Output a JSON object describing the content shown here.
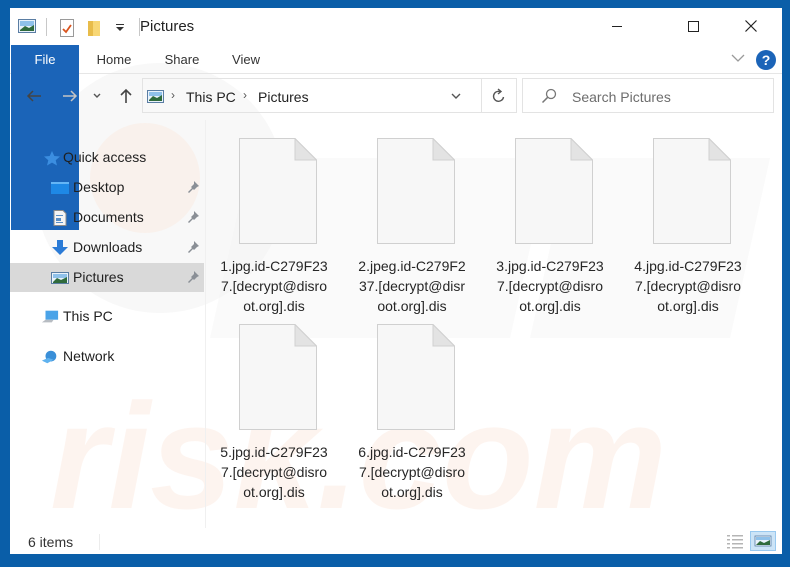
{
  "window": {
    "title": "Pictures",
    "controls": {
      "minimize": "—",
      "maximize": "☐",
      "close": "✕"
    }
  },
  "ribbon": {
    "tabs": [
      {
        "label": "File",
        "active": true
      },
      {
        "label": "Home"
      },
      {
        "label": "Share"
      },
      {
        "label": "View"
      }
    ],
    "help": "?"
  },
  "address": {
    "back": "←",
    "forward": "→",
    "recent": "⌄",
    "up": "↑",
    "breadcrumb": [
      "This PC",
      "Pictures"
    ],
    "separator": "›",
    "refresh": "↻"
  },
  "search": {
    "placeholder": "Search Pictures"
  },
  "navpane": {
    "quick_access": {
      "label": "Quick access"
    },
    "pinned": [
      {
        "label": "Desktop",
        "icon": "desktop-icon"
      },
      {
        "label": "Documents",
        "icon": "documents-icon"
      },
      {
        "label": "Downloads",
        "icon": "downloads-icon"
      },
      {
        "label": "Pictures",
        "icon": "pictures-icon",
        "selected": true
      }
    ],
    "this_pc": {
      "label": "This PC"
    },
    "network": {
      "label": "Network"
    }
  },
  "files": [
    {
      "name": "1.jpg.id-C279F237.[decrypt@disroot.org].dis",
      "lines": [
        "1.jpg.id-C279F23",
        "7.[decrypt@disro",
        "ot.org].dis"
      ]
    },
    {
      "name": "2.jpeg.id-C279F237.[decrypt@disroot.org].dis",
      "lines": [
        "2.jpeg.id-C279F2",
        "37.[decrypt@disr",
        "oot.org].dis"
      ]
    },
    {
      "name": "3.jpg.id-C279F237.[decrypt@disroot.org].dis",
      "lines": [
        "3.jpg.id-C279F23",
        "7.[decrypt@disro",
        "ot.org].dis"
      ]
    },
    {
      "name": "4.jpg.id-C279F237.[decrypt@disroot.org].dis",
      "lines": [
        "4.jpg.id-C279F23",
        "7.[decrypt@disro",
        "ot.org].dis"
      ]
    },
    {
      "name": "5.jpg.id-C279F237.[decrypt@disroot.org].dis",
      "lines": [
        "5.jpg.id-C279F23",
        "7.[decrypt@disro",
        "ot.org].dis"
      ]
    },
    {
      "name": "6.jpg.id-C279F237.[decrypt@disroot.org].dis",
      "lines": [
        "6.jpg.id-C279F23",
        "7.[decrypt@disro",
        "ot.org].dis"
      ]
    }
  ],
  "status": {
    "item_count": "6 items",
    "view": "large-icons"
  },
  "colors": {
    "accent": "#1b64b8",
    "border": "#0a5ea8",
    "selected": "#d9d9d9"
  }
}
